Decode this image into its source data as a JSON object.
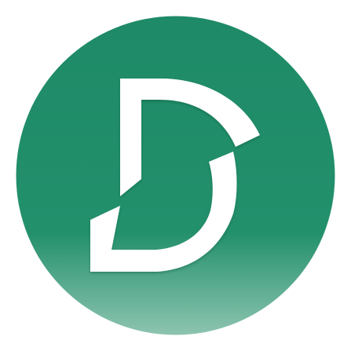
{
  "app_icon": {
    "icon_name": "letter-d-logo-icon",
    "letter_mark": "D",
    "colors": {
      "background": "#ffffff",
      "badge_top": "#1e8a67",
      "badge_mid": "#23906c",
      "badge_bottom": "#8dc4b0",
      "glyph": "#ffffff"
    }
  }
}
